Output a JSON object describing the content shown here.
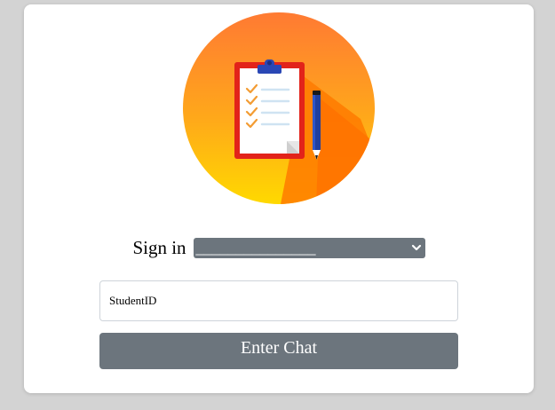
{
  "signin": {
    "label": "Sign in",
    "selected_value": "_______________"
  },
  "student_id": {
    "value": "",
    "placeholder": "StudentID"
  },
  "enter_button": {
    "label": "Enter Chat"
  },
  "logo": {
    "icon": "clipboard-checklist-pencil-icon"
  },
  "colors": {
    "background": "#d3d3d3",
    "card": "#ffffff",
    "button": "#6c757d",
    "logo_gradient_top": "#ff7a2e",
    "logo_gradient_bottom": "#ffd400",
    "clipboard_red": "#e0211b"
  }
}
